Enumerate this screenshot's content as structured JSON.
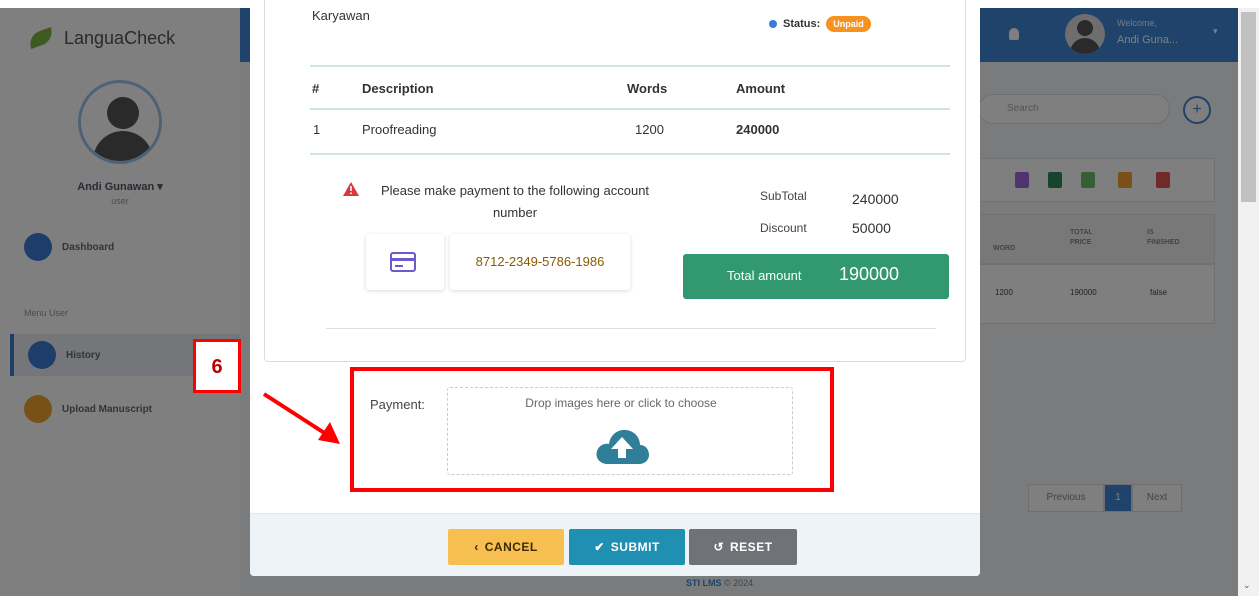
{
  "background": {
    "logo_text": "LanguaCheck",
    "profile_name": "Andi Gunawan ▾",
    "profile_role": "user",
    "nav": {
      "dashboard": "Dashboard",
      "menu_label": "Menu User",
      "history": "History",
      "upload": "Upload Manuscript"
    },
    "topbar": {
      "welcome": "Welcome,",
      "user": "Andi Guna...",
      "caret": "▾"
    },
    "search_placeholder": "Search",
    "plus": "+",
    "table": {
      "headers": [
        "WORD",
        "TOTAL PRICE",
        "IS FINISHED"
      ],
      "row": [
        "1200",
        "190000",
        "false"
      ]
    },
    "pager": {
      "previous": "Previous",
      "page": "1",
      "next": "Next"
    },
    "footer_brand": "STI LMS",
    "footer_year": "© 2024"
  },
  "invoice": {
    "customer_name": "Karyawan",
    "status_label": "Status:",
    "status_value": "Unpaid",
    "columns": {
      "num": "#",
      "description": "Description",
      "words": "Words",
      "amount": "Amount"
    },
    "row": {
      "num": "1",
      "description": "Proofreading",
      "words": "1200",
      "amount": "240000"
    },
    "payment_notice": "Please make payment to the following account number",
    "account_number": "8712-2349-5786-1986",
    "subtotal_label": "SubTotal",
    "subtotal_value": "240000",
    "discount_label": "Discount",
    "discount_value": "50000",
    "total_label": "Total amount",
    "total_value": "190000"
  },
  "upload": {
    "label": "Payment:",
    "dropzone_text": "Drop images here or click to choose",
    "icon": "cloud-upload-icon"
  },
  "footer": {
    "cancel": "CANCEL",
    "submit": "SUBMIT",
    "reset": "RESET"
  },
  "annotation": {
    "step_number": "6"
  },
  "colors": {
    "status_badge": "#f7921e",
    "total_box": "#319870",
    "cancel": "#f7bf4f",
    "submit": "#1f8fb2",
    "reset": "#6f7378",
    "annotation": "#ff0000",
    "upload_icon": "#2f7f98"
  }
}
